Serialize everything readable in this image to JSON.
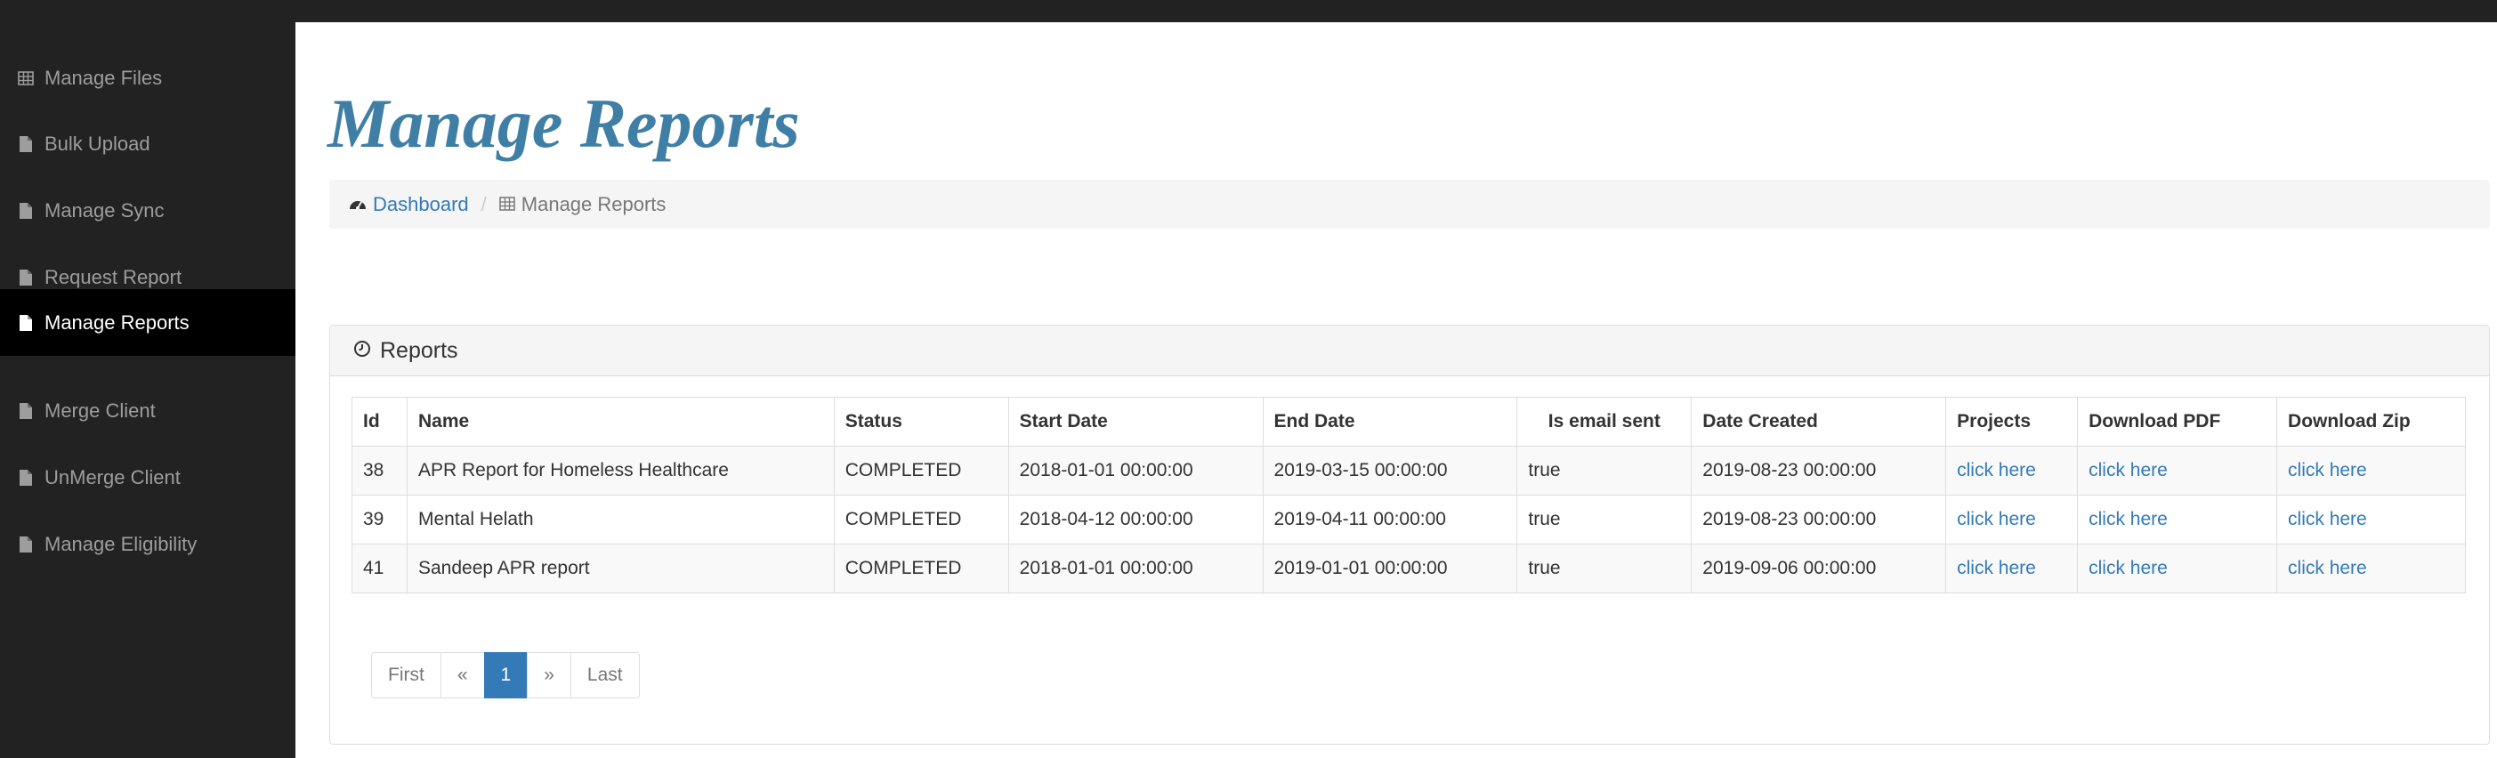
{
  "sidebar": {
    "items": [
      {
        "label": "Manage Files",
        "icon": "table-icon"
      },
      {
        "label": "Bulk Upload",
        "icon": "file-icon"
      },
      {
        "label": "Manage Sync",
        "icon": "file-icon"
      },
      {
        "label": "Request Report",
        "icon": "file-icon"
      },
      {
        "label": "Manage Reports",
        "icon": "file-icon",
        "active": true
      },
      {
        "label": "Merge Client",
        "icon": "file-icon"
      },
      {
        "label": "UnMerge Client",
        "icon": "file-icon"
      },
      {
        "label": "Manage Eligibility",
        "icon": "file-icon"
      }
    ]
  },
  "page": {
    "title": "Manage Reports"
  },
  "breadcrumb": {
    "home": "Dashboard",
    "separator": "/",
    "current": "Manage Reports"
  },
  "panel": {
    "title": "Reports"
  },
  "table": {
    "headers": [
      "Id",
      "Name",
      "Status",
      "Start Date",
      "End Date",
      "Is email sent",
      "Date Created",
      "Projects",
      "Download PDF",
      "Download Zip"
    ],
    "rows": [
      [
        "38",
        "APR Report for Homeless Healthcare",
        "COMPLETED",
        "2018-01-01 00:00:00",
        "2019-03-15 00:00:00",
        "true",
        "2019-08-23 00:00:00",
        "click here",
        "click here",
        "click here"
      ],
      [
        "39",
        "Mental Helath",
        "COMPLETED",
        "2018-04-12 00:00:00",
        "2019-04-11 00:00:00",
        "true",
        "2019-08-23 00:00:00",
        "click here",
        "click here",
        "click here"
      ],
      [
        "41",
        "Sandeep APR report",
        "COMPLETED",
        "2018-01-01 00:00:00",
        "2019-01-01 00:00:00",
        "true",
        "2019-09-06 00:00:00",
        "click here",
        "click here",
        "click here"
      ]
    ]
  },
  "pagination": {
    "first": "First",
    "prev": "«",
    "current": "1",
    "next": "»",
    "last": "Last"
  },
  "colors": {
    "sidebar_bg": "#222222",
    "active_bg": "#000000",
    "title": "#3f7fa6",
    "link": "#337ab7"
  }
}
